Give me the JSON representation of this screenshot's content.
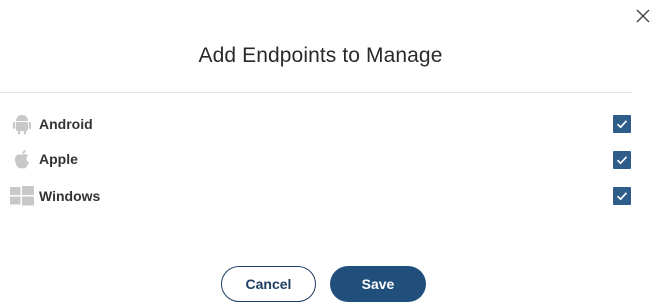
{
  "dialog": {
    "title": "Add Endpoints to Manage",
    "close_icon": "close-icon"
  },
  "endpoints": [
    {
      "label": "Android",
      "icon": "android-icon",
      "checked": true
    },
    {
      "label": "Apple",
      "icon": "apple-icon",
      "checked": true
    },
    {
      "label": "Windows",
      "icon": "windows-icon",
      "checked": true
    }
  ],
  "actions": {
    "cancel_label": "Cancel",
    "save_label": "Save"
  },
  "colors": {
    "checkbox": "#2f5d8a",
    "primary": "#1f4f7a",
    "icon_gray": "#c8c8c8"
  }
}
